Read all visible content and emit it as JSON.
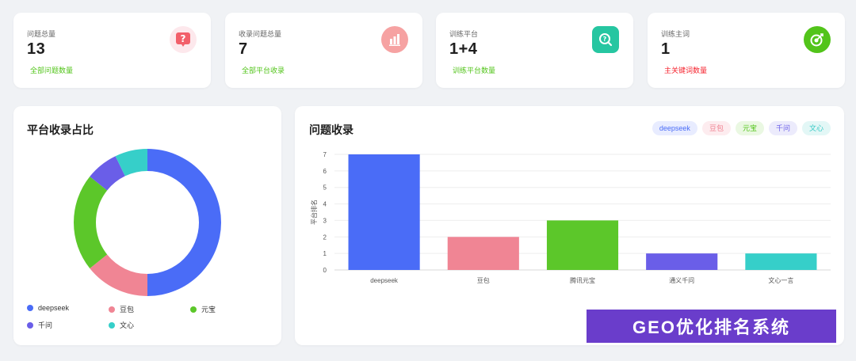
{
  "stats": [
    {
      "label": "问题总量",
      "value": "13",
      "sub": "全部问题数量",
      "sub_color": "#52c41a",
      "icon": "question-bubble-icon",
      "badge_bg": "#fde8ec",
      "badge_fg": "#f25f6a"
    },
    {
      "label": "收录问题总量",
      "value": "7",
      "sub": "全部平台收录",
      "sub_color": "#52c41a",
      "icon": "bar-chart-icon",
      "badge_bg": "#f6a2a2",
      "badge_fg": "#ffffff"
    },
    {
      "label": "训练平台",
      "value": "1+4",
      "sub": "训练平台数量",
      "sub_color": "#52c41a",
      "icon": "search-circle-icon",
      "badge_bg": "#26c6a1",
      "badge_fg": "#ffffff"
    },
    {
      "label": "训练主词",
      "value": "1",
      "sub": "主关键词数量",
      "sub_color": "#f5222d",
      "icon": "target-icon",
      "badge_bg": "#52c41a",
      "badge_fg": "#ffffff"
    }
  ],
  "pie": {
    "title": "平台收录占比"
  },
  "bar": {
    "title": "问题收录",
    "chips": [
      {
        "label": "deepseek",
        "bg": "#e8ecff",
        "fg": "#4a6cf7"
      },
      {
        "label": "豆包",
        "bg": "#fdecef",
        "fg": "#f0808f"
      },
      {
        "label": "元宝",
        "bg": "#eaf8e2",
        "fg": "#52c41a"
      },
      {
        "label": "千问",
        "bg": "#ecebfc",
        "fg": "#6a5ee8"
      },
      {
        "label": "文心",
        "bg": "#e3f7f6",
        "fg": "#36c9c6"
      }
    ]
  },
  "chart_data": [
    {
      "type": "pie",
      "title": "平台收录占比",
      "categories": [
        "deepseek",
        "豆包",
        "元宝",
        "千问",
        "文心"
      ],
      "values": [
        7,
        2,
        3,
        1,
        1
      ],
      "colors": [
        "#4a6cf7",
        "#f08594",
        "#5cc72a",
        "#6a5ee8",
        "#36cfc9"
      ],
      "donut": true,
      "legend": "bottom"
    },
    {
      "type": "bar",
      "title": "问题收录",
      "categories": [
        "deepseek",
        "豆包",
        "腾讯元宝",
        "通义千问",
        "文心一言"
      ],
      "values": [
        7,
        2,
        3,
        1,
        1
      ],
      "colors": [
        "#4a6cf7",
        "#f08594",
        "#5cc72a",
        "#6a5ee8",
        "#36cfc9"
      ],
      "ylabel": "平台排名",
      "xlabel": "",
      "ylim": [
        0,
        7
      ],
      "yticks": [
        0,
        1,
        2,
        3,
        4,
        5,
        6,
        7
      ],
      "grid": true
    }
  ],
  "watermark": "GEO优化排名系统"
}
